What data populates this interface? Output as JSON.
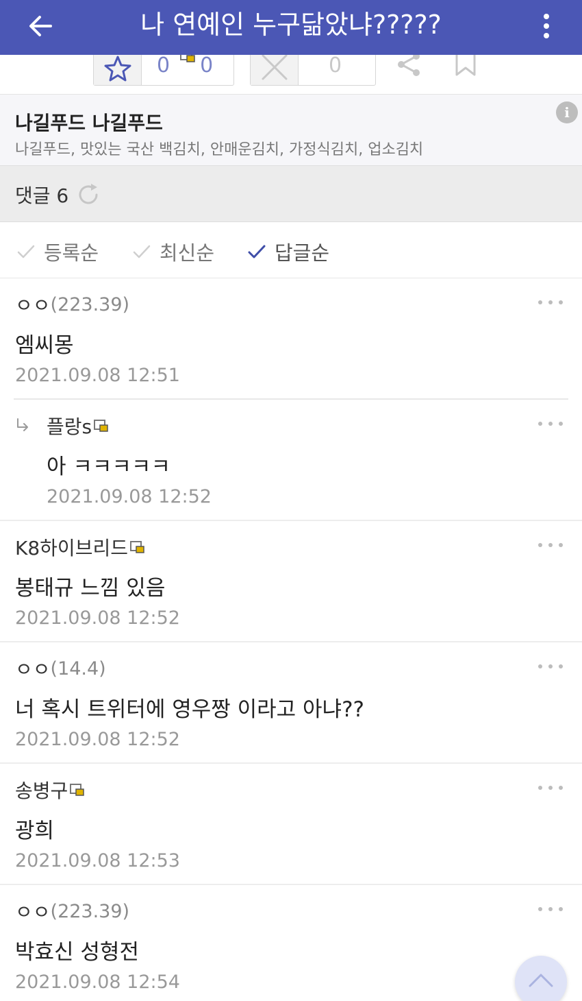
{
  "header": {
    "title": "나 연예인 누구닮았냐?????",
    "back_icon": "arrow-left-icon",
    "menu_icon": "more-vertical-icon"
  },
  "votes": {
    "recommend_count": "0",
    "fixed_recommend_count": "0",
    "downvote_count": "0"
  },
  "gallery": {
    "name": "나길푸드 나길푸드",
    "description": "나길푸드, 맛있는 국산 백김치, 안매운김치, 가정식김치, 업소김치",
    "info_icon": "i"
  },
  "comment_header": {
    "label": "댓글 6"
  },
  "sort_options": [
    {
      "label": "등록순",
      "active": false
    },
    {
      "label": "최신순",
      "active": false
    },
    {
      "label": "답글순",
      "active": true
    }
  ],
  "comments": [
    {
      "author": "ㅇㅇ",
      "ip": "(223.39)",
      "body": "엠씨몽",
      "date": "2021.09.08 12:51",
      "reply": false,
      "member": false
    },
    {
      "author": "플랑s",
      "ip": "",
      "body": "아 ㅋㅋㅋㅋㅋ",
      "date": "2021.09.08 12:52",
      "reply": true,
      "member": true
    },
    {
      "author": "K8하이브리드",
      "ip": "",
      "body": "봉태규 느낌 있음",
      "date": "2021.09.08 12:52",
      "reply": false,
      "member": true
    },
    {
      "author": "ㅇㅇ",
      "ip": "(14.4)",
      "body": "너 혹시 트위터에 영우짱 이라고 아냐??",
      "date": "2021.09.08 12:52",
      "reply": false,
      "member": false
    },
    {
      "author": "송병구",
      "ip": "",
      "body": "광희",
      "date": "2021.09.08 12:53",
      "reply": false,
      "member": true
    },
    {
      "author": "ㅇㅇ",
      "ip": "(223.39)",
      "body": "박효신 성형전",
      "date": "2021.09.08 12:54",
      "reply": false,
      "member": false
    }
  ],
  "colors": {
    "appbar": "#4b57b5",
    "accent": "#3f4ea8",
    "member_badge": "#e0b400"
  }
}
